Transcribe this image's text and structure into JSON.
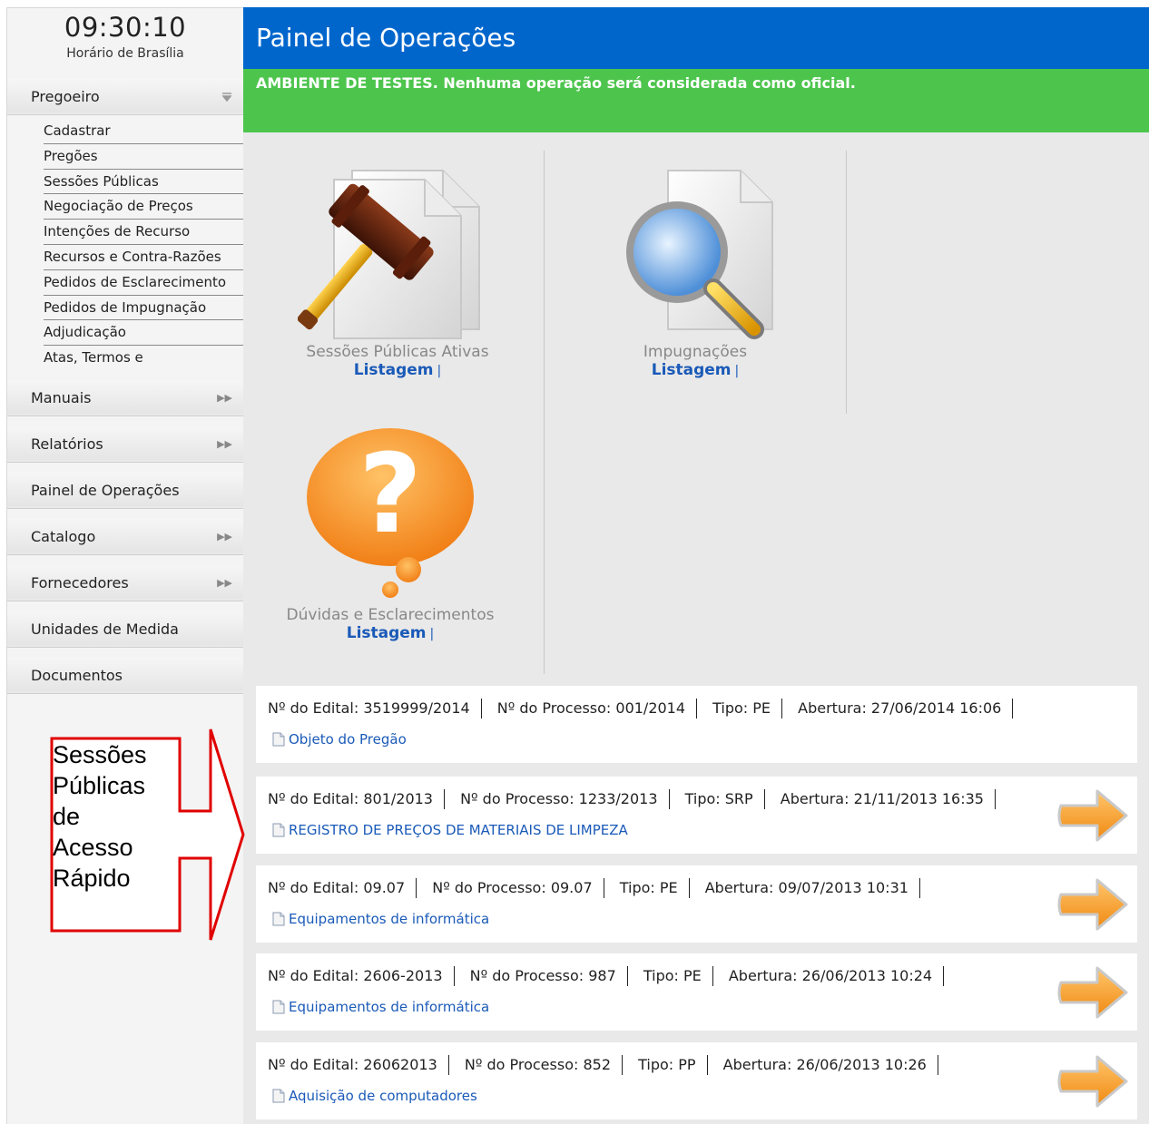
{
  "clock": {
    "time": "09:30:10",
    "label": "Horário de Brasília"
  },
  "sidebar": {
    "pregoeiro": "Pregoeiro",
    "submenu": [
      "Cadastrar",
      "Pregões",
      "Sessões Públicas",
      "Negociação de Preços",
      "Intenções de Recurso",
      "Recursos e Contra-Razões",
      "Pedidos de Esclarecimento",
      "Pedidos de Impugnação",
      "Adjudicação",
      "Atas, Termos e"
    ],
    "items": [
      {
        "label": "Manuais"
      },
      {
        "label": "Relatórios"
      },
      {
        "label": "Painel de Operações"
      },
      {
        "label": "Catalogo"
      },
      {
        "label": "Fornecedores"
      },
      {
        "label": "Unidades de Medida"
      },
      {
        "label": "Documentos"
      }
    ]
  },
  "header": {
    "title": "Painel de Operações"
  },
  "banner": {
    "text": "AMBIENTE DE TESTES. Nenhuma operação será considerada como oficial."
  },
  "tiles": [
    {
      "label": "Sessões Públicas Ativas",
      "link": "Listagem",
      "sep": "|"
    },
    {
      "label": "Impugnações",
      "link": "Listagem",
      "sep": "|"
    },
    {
      "label": "Dúvidas e Esclarecimentos",
      "link": "Listagem",
      "sep": "|"
    }
  ],
  "sessions": [
    {
      "edital": "Nº do Edital: 3519999/2014",
      "processo": "Nº do Processo: 001/2014",
      "tipo": "Tipo: PE",
      "abertura": "Abertura: 27/06/2014 16:06",
      "objeto": "Objeto do Pregão"
    },
    {
      "edital": "Nº do Edital: 801/2013",
      "processo": "Nº do Processo: 1233/2013",
      "tipo": "Tipo: SRP",
      "abertura": "Abertura: 21/11/2013 16:35",
      "objeto": "REGISTRO DE PREÇOS DE MATERIAIS DE LIMPEZA"
    },
    {
      "edital": "Nº do Edital: 09.07",
      "processo": "Nº do Processo: 09.07",
      "tipo": "Tipo: PE",
      "abertura": "Abertura: 09/07/2013 10:31",
      "objeto": "Equipamentos de informática"
    },
    {
      "edital": "Nº do Edital: 2606-2013",
      "processo": "Nº do Processo: 987",
      "tipo": "Tipo: PE",
      "abertura": "Abertura: 26/06/2013 10:24",
      "objeto": "Equipamentos de informática"
    },
    {
      "edital": "Nº do Edital: 26062013",
      "processo": "Nº do Processo: 852",
      "tipo": "Tipo: PP",
      "abertura": "Abertura: 26/06/2013 10:26",
      "objeto": "Aquisição de computadores"
    }
  ],
  "annotation": {
    "lines": [
      "Sessões",
      "Públicas",
      "de",
      "Acesso",
      "Rápido"
    ]
  },
  "colors": {
    "header": "#0066cc",
    "banner": "#4dc54d",
    "link": "#1a5ab8",
    "annotation": "#e00000",
    "arrow": "#f7941d"
  }
}
